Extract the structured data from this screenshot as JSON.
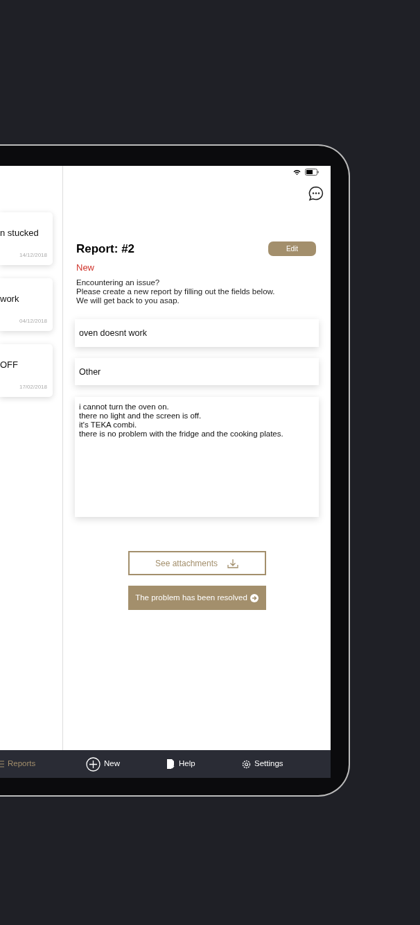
{
  "reports": [
    {
      "title": "n stucked",
      "date": "14/12/2018"
    },
    {
      "title": "work",
      "date": "04/12/2018"
    },
    {
      "title": "OFF",
      "date": "17/02/2018"
    }
  ],
  "report": {
    "title": "Report: #2",
    "status": "New",
    "edit_button": "Edit",
    "intro": [
      "Encountering an issue?",
      "Please create a new report by filling out the fields below.",
      "We will get back to you asap."
    ],
    "subject": "oven doesnt work",
    "category": "Other",
    "description": [
      "i cannot turn the oven on.",
      "there no light and the screen is off.",
      "it's TEKA combi.",
      "there is no problem with the fridge and the cooking plates."
    ],
    "attachments_button": "See attachments",
    "resolve_button": "The problem has been resolved"
  },
  "tab_bar": [
    {
      "kind": "list",
      "label": "Reports",
      "selected": true
    },
    {
      "kind": "plus",
      "label": "New",
      "selected": false
    },
    {
      "kind": "document",
      "label": "Help",
      "selected": false
    },
    {
      "kind": "gear",
      "label": "Settings",
      "selected": false
    }
  ]
}
